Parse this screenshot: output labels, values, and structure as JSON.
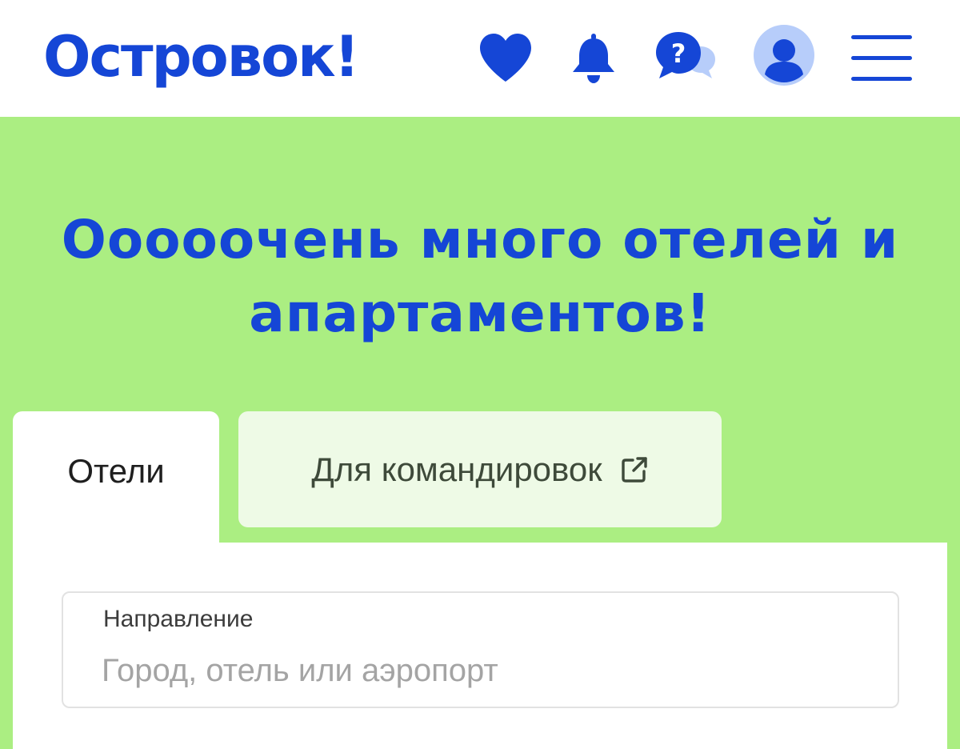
{
  "header": {
    "logo": "Островок!",
    "icons": [
      "heart-icon",
      "bell-icon",
      "help-chat-icon",
      "avatar-icon",
      "menu-icon"
    ]
  },
  "hero": {
    "title_line1": "Ооооочень много отелей и",
    "title_line2": "апартаментов!"
  },
  "tabs": [
    {
      "label": "Отели",
      "active": true
    },
    {
      "label": "Для командировок",
      "active": false,
      "icon": "external-link-icon"
    }
  ],
  "search": {
    "destination_label": "Направление",
    "destination_placeholder": "Город, отель или аэропорт",
    "destination_value": ""
  },
  "colors": {
    "brand_blue": "#1546d6",
    "hero_green": "#abee82",
    "inactive_tab": "#eefae6",
    "avatar_bg": "#b7cdfa"
  }
}
